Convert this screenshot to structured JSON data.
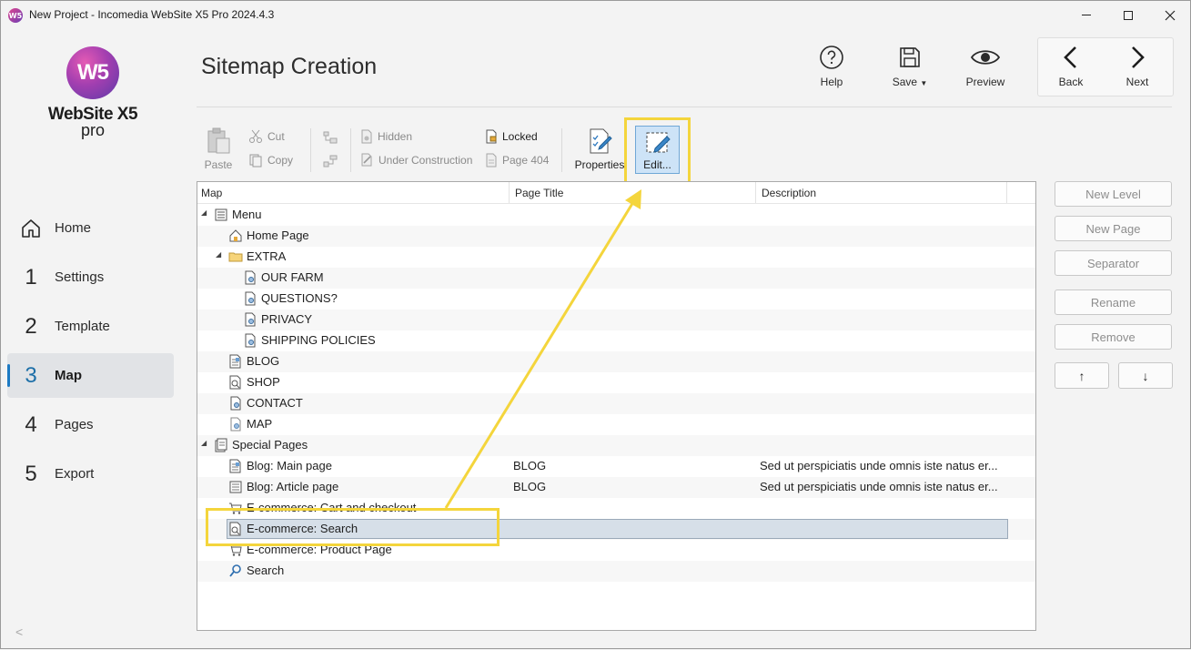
{
  "window": {
    "title": "New Project - Incomedia WebSite X5 Pro 2024.4.3",
    "app_icon_text": "W5"
  },
  "brand": {
    "logo_text": "W5",
    "name": "WebSite X5",
    "edition": "pro"
  },
  "sidebar": {
    "items": [
      {
        "num": "",
        "label": "Home",
        "icon": "house-icon"
      },
      {
        "num": "1",
        "label": "Settings"
      },
      {
        "num": "2",
        "label": "Template"
      },
      {
        "num": "3",
        "label": "Map",
        "active": true
      },
      {
        "num": "4",
        "label": "Pages"
      },
      {
        "num": "5",
        "label": "Export"
      }
    ],
    "collapse_glyph": "<"
  },
  "header": {
    "title": "Sitemap Creation",
    "help": "Help",
    "save": "Save",
    "preview": "Preview",
    "back": "Back",
    "next": "Next"
  },
  "ribbon": {
    "paste": "Paste",
    "cut": "Cut",
    "copy": "Copy",
    "hidden": "Hidden",
    "under_construction": "Under Construction",
    "locked": "Locked",
    "page404": "Page 404",
    "properties": "Properties",
    "edit": "Edit..."
  },
  "tree": {
    "columns": [
      "Map",
      "Page Title",
      "Description"
    ],
    "rows": [
      {
        "label": "Menu",
        "level": 0,
        "toggle": "◢",
        "icon": "menu-icon",
        "title": "",
        "desc": ""
      },
      {
        "label": "Home Page",
        "level": 1,
        "toggle": "",
        "icon": "home-page-icon",
        "title": "",
        "desc": ""
      },
      {
        "label": "EXTRA",
        "level": 1,
        "toggle": "◢",
        "icon": "folder-icon",
        "title": "",
        "desc": ""
      },
      {
        "label": "OUR FARM",
        "level": 2,
        "toggle": "",
        "icon": "page-icon",
        "title": "",
        "desc": ""
      },
      {
        "label": "QUESTIONS?",
        "level": 2,
        "toggle": "",
        "icon": "page-icon",
        "title": "",
        "desc": ""
      },
      {
        "label": "PRIVACY",
        "level": 2,
        "toggle": "",
        "icon": "page-icon",
        "title": "",
        "desc": ""
      },
      {
        "label": "SHIPPING POLICIES",
        "level": 2,
        "toggle": "",
        "icon": "page-icon",
        "title": "",
        "desc": ""
      },
      {
        "label": "BLOG",
        "level": 1,
        "toggle": "",
        "icon": "blog-icon",
        "title": "",
        "desc": ""
      },
      {
        "label": "SHOP",
        "level": 1,
        "toggle": "",
        "icon": "shop-icon",
        "title": "",
        "desc": ""
      },
      {
        "label": "CONTACT",
        "level": 1,
        "toggle": "",
        "icon": "page-icon",
        "title": "",
        "desc": ""
      },
      {
        "label": "MAP",
        "level": 1,
        "toggle": "",
        "icon": "map-page-icon",
        "title": "",
        "desc": ""
      },
      {
        "label": "Special Pages",
        "level": 0,
        "toggle": "◢",
        "icon": "special-pages-icon",
        "title": "",
        "desc": ""
      },
      {
        "label": "Blog: Main page",
        "level": 1,
        "toggle": "",
        "icon": "blog-icon",
        "title": "BLOG",
        "desc": "Sed ut perspiciatis unde omnis iste natus er..."
      },
      {
        "label": "Blog: Article page",
        "level": 1,
        "toggle": "",
        "icon": "article-icon",
        "title": "BLOG",
        "desc": "Sed ut perspiciatis unde omnis iste natus er..."
      },
      {
        "label": "E-commerce: Cart and checkout",
        "level": 1,
        "toggle": "",
        "icon": "cart-icon",
        "title": "",
        "desc": ""
      },
      {
        "label": "E-commerce: Search",
        "level": 1,
        "toggle": "",
        "icon": "shop-icon",
        "title": "",
        "desc": "",
        "selected": true
      },
      {
        "label": "E-commerce: Product Page",
        "level": 1,
        "toggle": "",
        "icon": "cart-icon",
        "title": "",
        "desc": ""
      },
      {
        "label": "Search",
        "level": 1,
        "toggle": "",
        "icon": "search-icon",
        "title": "",
        "desc": ""
      }
    ]
  },
  "side_buttons": {
    "new_level": "New Level",
    "new_page": "New Page",
    "separator": "Separator",
    "rename": "Rename",
    "remove": "Remove",
    "up": "↑",
    "down": "↓"
  },
  "colors": {
    "highlight": "#f4d53c",
    "accent": "#1d7ac3",
    "selection": "#d6dfe8"
  }
}
